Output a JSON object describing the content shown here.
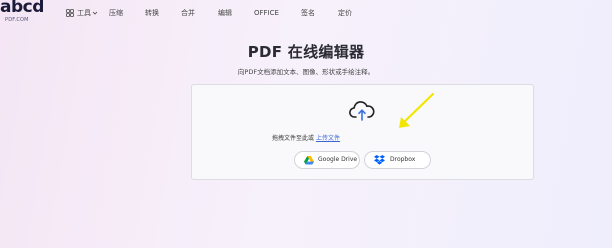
{
  "brand": {
    "logo_text": "abcd",
    "logo_sub": "PDF.COM"
  },
  "nav": {
    "items": [
      {
        "label": "工具"
      },
      {
        "label": "压缩"
      },
      {
        "label": "转换"
      },
      {
        "label": "合并"
      },
      {
        "label": "编辑"
      },
      {
        "label": "OFFICE"
      },
      {
        "label": "签名"
      },
      {
        "label": "定价"
      }
    ]
  },
  "main": {
    "title": "PDF 在线编辑器",
    "subtitle": "向PDF文档添加文本、图像、形状或手绘注释。",
    "drop_prefix": "拖拽文件至此或",
    "drop_link": "上传文件",
    "buttons": [
      {
        "label": "Google Drive",
        "icon": "google-drive-icon"
      },
      {
        "label": "Dropbox",
        "icon": "dropbox-icon"
      }
    ]
  },
  "colors": {
    "link": "#3a66d8",
    "annotation_arrow": "#f2e600",
    "dropbox": "#0061fe",
    "upload_arrow": "#3b6fe0"
  }
}
